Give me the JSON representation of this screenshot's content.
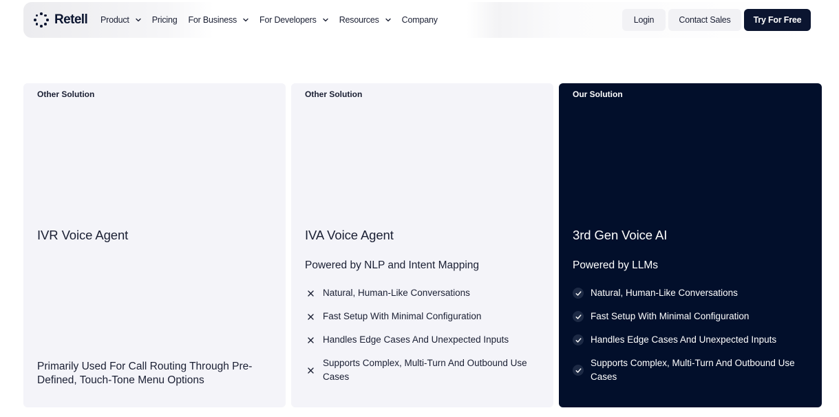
{
  "brand": {
    "name": "Retell"
  },
  "nav": {
    "items": [
      {
        "label": "Product",
        "dropdown": true
      },
      {
        "label": "Pricing",
        "dropdown": false
      },
      {
        "label": "For Business",
        "dropdown": true
      },
      {
        "label": "For Developers",
        "dropdown": true
      },
      {
        "label": "Resources",
        "dropdown": true
      },
      {
        "label": "Company",
        "dropdown": false
      }
    ],
    "login_label": "Login",
    "contact_label": "Contact Sales",
    "try_label": "Try For Free"
  },
  "colors": {
    "primary_dark": "#020f2b",
    "card_light": "#f4f4f9",
    "text": "#1a1f33"
  },
  "cards": [
    {
      "tag": "Other Solution",
      "title": "IVR Voice Agent",
      "description": "Primarily Used For Call Routing Through Pre-Defined, Touch-Tone Menu Options"
    },
    {
      "tag": "Other Solution",
      "title": "IVA Voice Agent",
      "subtitle": "Powered by NLP and Intent Mapping",
      "features": [
        {
          "text": "Natural, Human-Like Conversations",
          "icon": "x-icon"
        },
        {
          "text": "Fast Setup With Minimal Configuration",
          "icon": "x-icon"
        },
        {
          "text": "Handles Edge Cases And Unexpected Inputs",
          "icon": "x-icon"
        },
        {
          "text": "Supports Complex, Multi-Turn And Outbound Use Cases",
          "icon": "x-icon"
        }
      ]
    },
    {
      "tag": "Our Solution",
      "title": "3rd Gen Voice AI",
      "subtitle": "Powered by LLMs",
      "features": [
        {
          "text": "Natural, Human-Like Conversations",
          "icon": "check-icon"
        },
        {
          "text": "Fast Setup With Minimal Configuration",
          "icon": "check-icon"
        },
        {
          "text": "Handles Edge Cases And Unexpected Inputs",
          "icon": "check-icon"
        },
        {
          "text": "Supports Complex, Multi-Turn And Outbound Use Cases",
          "icon": "check-icon"
        }
      ]
    }
  ]
}
